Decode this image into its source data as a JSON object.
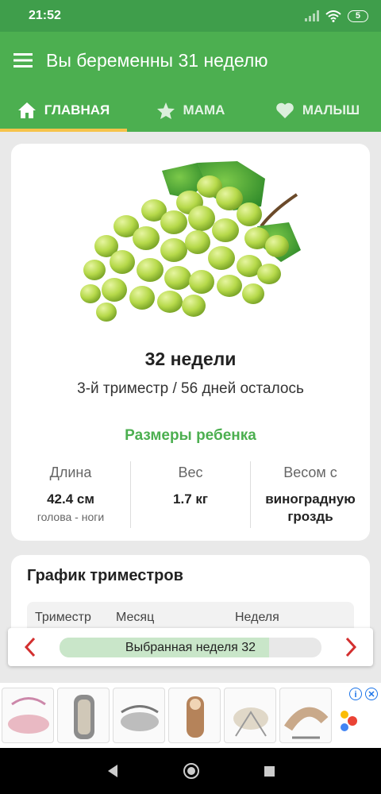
{
  "status": {
    "time": "21:52",
    "battery": "5"
  },
  "appbar": {
    "title": "Вы беременны 31 неделю"
  },
  "tabs": [
    {
      "label": "ГЛАВНАЯ",
      "icon": "home-icon",
      "active": true
    },
    {
      "label": "МАМА",
      "icon": "star-icon",
      "active": false
    },
    {
      "label": "МАЛЫШ",
      "icon": "heart-icon",
      "active": false
    }
  ],
  "main": {
    "week_title": "32 недели",
    "subtitle": "3-й триместр / 56 дней осталось",
    "sizes_title": "Размеры ребенка",
    "image": "grapes-image",
    "stats": [
      {
        "label": "Длина",
        "value": "42.4 см",
        "note": "голова - ноги"
      },
      {
        "label": "Вес",
        "value": "1.7 кг",
        "note": ""
      },
      {
        "label": "Весом с",
        "value": "виноградную гроздь",
        "note": ""
      }
    ]
  },
  "trimesters": {
    "title": "График триместров",
    "columns": [
      "Триместр",
      "Месяц",
      "Неделя"
    ]
  },
  "week_selector": {
    "text": "Выбранная неделя 32",
    "week": 32,
    "total_weeks": 40
  },
  "colors": {
    "primary": "#4caf50",
    "statusbar": "#3f9e4b",
    "accent": "#f6c34a",
    "arrow": "#d32f2f"
  }
}
